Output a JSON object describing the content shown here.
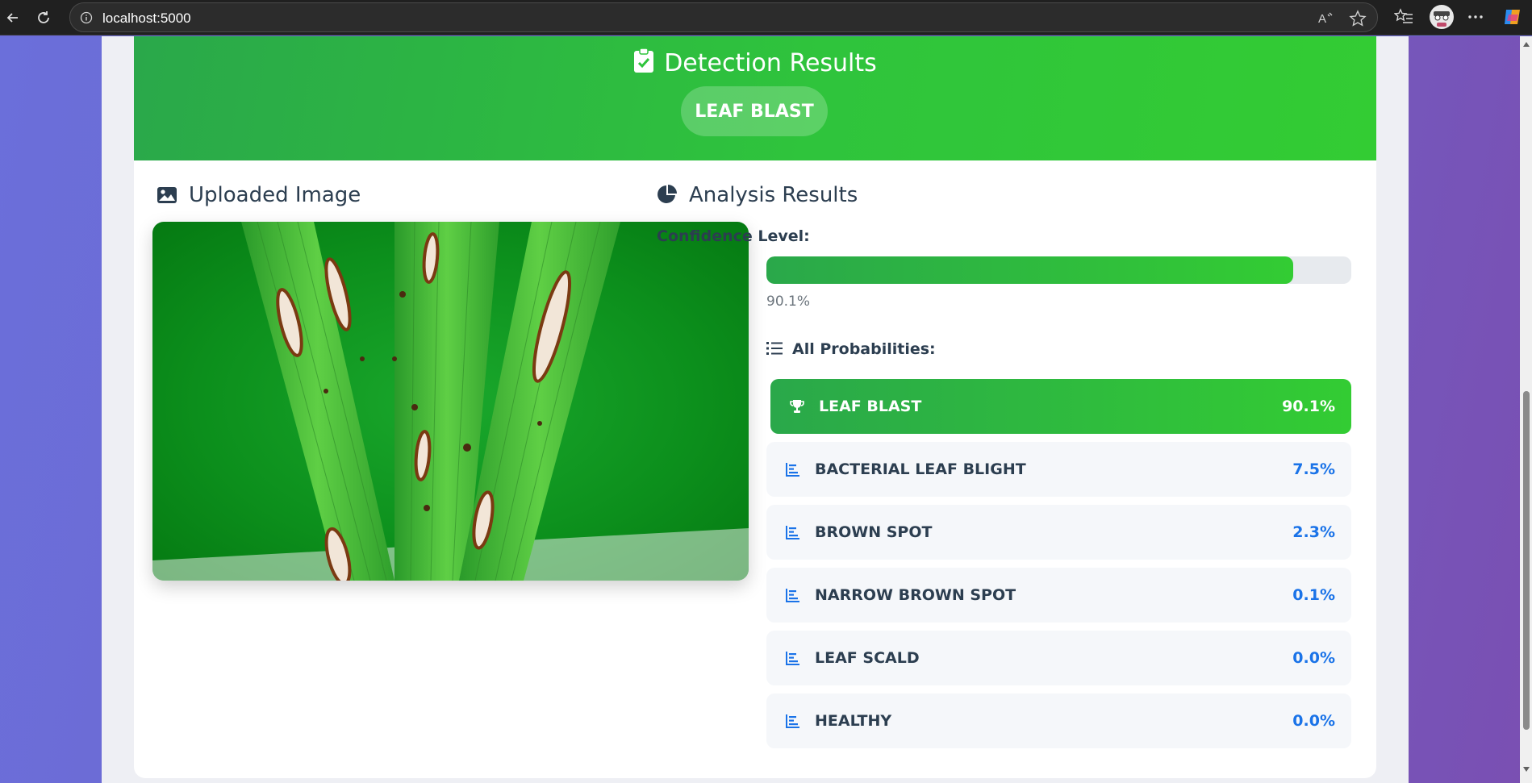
{
  "browser": {
    "url": "localhost:5000",
    "icons": [
      "back-icon",
      "reload-icon",
      "info-icon",
      "read-aloud-icon",
      "favorite-star-icon",
      "favorites-list-icon",
      "profile-avatar",
      "more-icon",
      "copilot-icon"
    ]
  },
  "header": {
    "title": "Detection Results",
    "title_icon": "clipboard-check-icon",
    "result_badge": "LEAF BLAST",
    "color": "#2fc43c"
  },
  "uploaded": {
    "title": "Uploaded Image",
    "icon": "image-icon"
  },
  "analysis": {
    "title": "Analysis Results",
    "icon": "pie-chart-icon",
    "confidence_label": "Confidence Level:",
    "confidence_value": 0.901,
    "confidence_text": "90.1%",
    "probabilities_label": "All Probabilities:",
    "probabilities_icon": "list-icon",
    "probabilities": [
      {
        "name": "LEAF BLAST",
        "value": "90.1%",
        "icon": "trophy-icon",
        "top": true
      },
      {
        "name": "BACTERIAL LEAF BLIGHT",
        "value": "7.5%",
        "icon": "chart-bar-icon",
        "top": false
      },
      {
        "name": "BROWN SPOT",
        "value": "2.3%",
        "icon": "chart-bar-icon",
        "top": false
      },
      {
        "name": "NARROW BROWN SPOT",
        "value": "0.1%",
        "icon": "chart-bar-icon",
        "top": false
      },
      {
        "name": "LEAF SCALD",
        "value": "0.0%",
        "icon": "chart-bar-icon",
        "top": false
      },
      {
        "name": "HEALTHY",
        "value": "0.0%",
        "icon": "chart-bar-icon",
        "top": false
      }
    ]
  },
  "colors": {
    "accent_green": "#2fc43c",
    "value_blue": "#1a73e8",
    "text_dark": "#2c3e50"
  }
}
